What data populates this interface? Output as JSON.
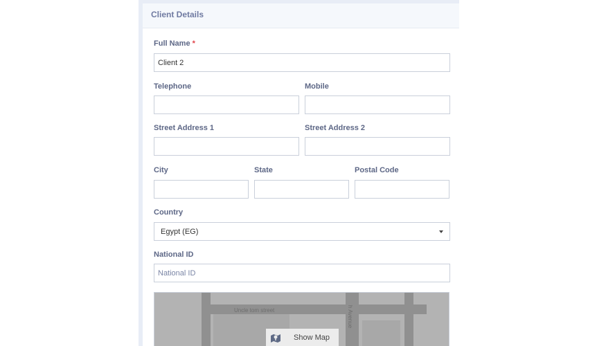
{
  "card": {
    "title": "Client Details"
  },
  "form": {
    "full_name": {
      "label": "Full Name",
      "required_mark": "*",
      "value": "Client 2"
    },
    "telephone": {
      "label": "Telephone",
      "value": ""
    },
    "mobile": {
      "label": "Mobile",
      "value": ""
    },
    "street1": {
      "label": "Street Address 1",
      "value": ""
    },
    "street2": {
      "label": "Street Address 2",
      "value": ""
    },
    "city": {
      "label": "City",
      "value": ""
    },
    "state": {
      "label": "State",
      "value": ""
    },
    "postal": {
      "label": "Postal Code",
      "value": ""
    },
    "country": {
      "label": "Country",
      "value": "Egypt (EG)"
    },
    "national_id": {
      "label": "National ID",
      "placeholder": "National ID",
      "value": ""
    }
  },
  "map": {
    "street_label": "Uncle tom street",
    "avenue_label": "h Avenue",
    "show_map_label": "Show Map",
    "icon": "map-icon"
  }
}
